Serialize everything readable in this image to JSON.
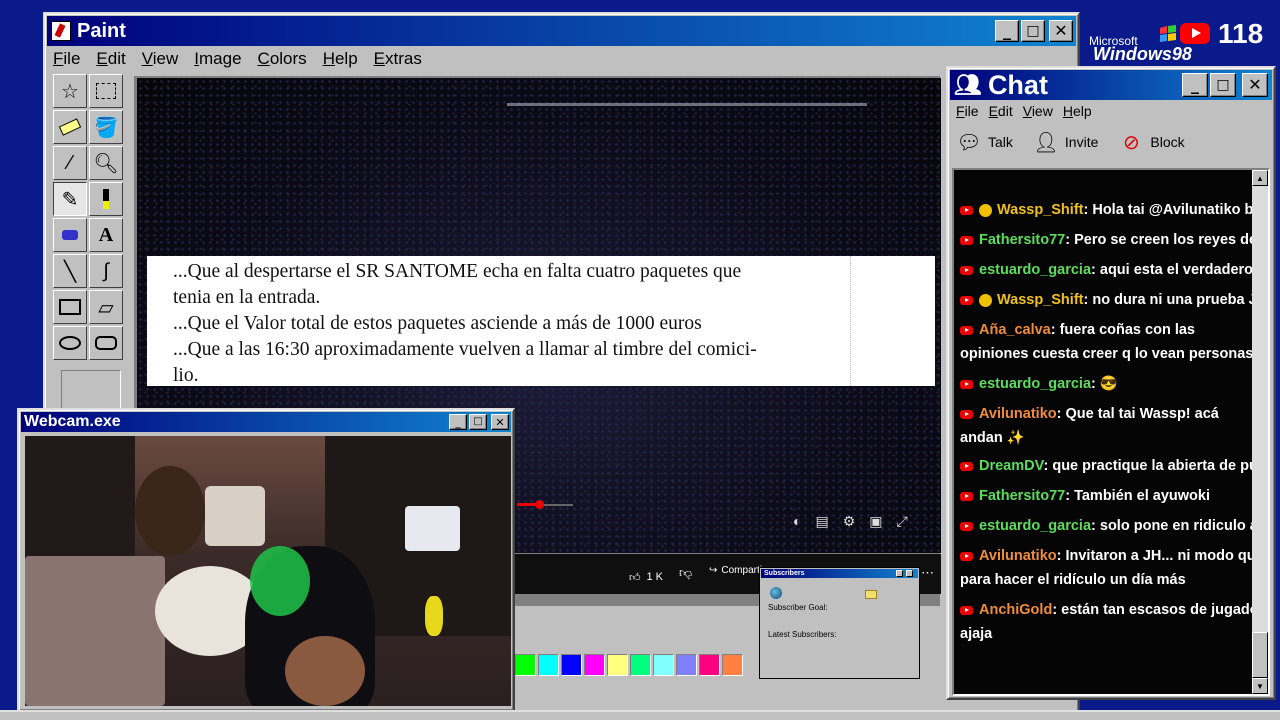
{
  "paint": {
    "title": "Paint",
    "menu": [
      "File",
      "Edit",
      "View",
      "Image",
      "Colors",
      "Help",
      "Extras"
    ],
    "document_lines": [
      "...Que al despertarse el SR SANTOME echa en falta cuatro paquetes que",
      "tenia en la entrada.",
      "...Que el Valor total de estos paquetes asciende a más de 1000 euros",
      "...Que a las 16:30 aproximadamente vuelven a llamar al timbre del comici-",
      "lio."
    ],
    "video": {
      "like_count": "1 K",
      "share_label": "Compartir"
    },
    "palette": [
      "#00ff00",
      "#00ffff",
      "#0000ff",
      "#ff00ff",
      "#ffff80",
      "#00ff80",
      "#80ffff",
      "#8080ff",
      "#ff0080",
      "#ff8040"
    ],
    "tools": [
      "free-select",
      "rect-select",
      "eraser",
      "fill",
      "color-picker",
      "magnifier",
      "pencil",
      "brush",
      "airbrush",
      "text",
      "line",
      "curve",
      "rectangle",
      "polygon",
      "ellipse",
      "rounded-rect"
    ]
  },
  "subscribers": {
    "title": "Subscribers",
    "goal_label": "Subscriber Goal:",
    "latest_label": "Latest Subscribers:"
  },
  "brand": {
    "microsoft": "Microsoft",
    "windows": "Windows98",
    "youtube_count": "118"
  },
  "chat": {
    "title": "Chat",
    "menu": [
      "File",
      "Edit",
      "View",
      "Help"
    ],
    "toolbar": {
      "talk": "Talk",
      "invite": "Invite",
      "block": "Block"
    },
    "messages": [
      {
        "user": "Wassp_Shift",
        "color": "#f0c020",
        "mod": true,
        "text": ": Hola tai @Avilunatiko bue"
      },
      {
        "user": "Fathersito77",
        "color": "#5ddc5d",
        "mod": false,
        "text": ": Pero se creen los reyes del"
      },
      {
        "user": "estuardo_garcia",
        "color": "#5ddc5d",
        "mod": false,
        "text": ": aqui esta el verdadero c"
      },
      {
        "user": "Wassp_Shift",
        "color": "#f0c020",
        "mod": true,
        "text": ": no dura ni una prueba JA"
      },
      {
        "user": "Aña_calva",
        "color": "#f08c3c",
        "mod": false,
        "text": ": fuera coñas con las opiniones cuesta creer q lo vean personas"
      },
      {
        "user": "estuardo_garcia",
        "color": "#5ddc5d",
        "mod": false,
        "text": ": 😎"
      },
      {
        "user": "Avilunatiko",
        "color": "#f08c3c",
        "mod": false,
        "text": ": Que tal tai Wassp! acá andan ✨"
      },
      {
        "user": "DreamDV",
        "color": "#5ddc5d",
        "mod": false,
        "text": ": que practique la abierta de pue"
      },
      {
        "user": "Fathersito77",
        "color": "#5ddc5d",
        "mod": false,
        "text": ": También el ayuwoki"
      },
      {
        "user": "estuardo_garcia",
        "color": "#5ddc5d",
        "mod": false,
        "text": ": solo pone en ridiculo a l"
      },
      {
        "user": "Avilunatiko",
        "color": "#f08c3c",
        "mod": false,
        "text": ": Invitaron a JH... ni modo que para hacer el ridículo un día más"
      },
      {
        "user": "AnchiGold",
        "color": "#f08c3c",
        "mod": false,
        "text": ": están tan escasos de jugador ajaja"
      }
    ]
  },
  "webcam": {
    "title": "Webcam.exe"
  }
}
